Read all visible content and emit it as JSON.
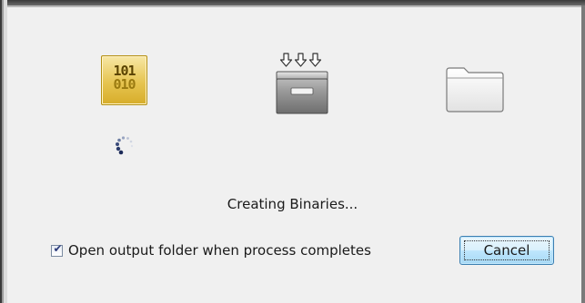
{
  "steps": {
    "binary_icon": {
      "name": "binary-icon",
      "line1": "101",
      "line2": "010"
    },
    "install_icon": {
      "name": "install-drive-icon"
    },
    "folder_icon": {
      "name": "folder-icon"
    },
    "spinner": {
      "name": "loading-spinner-icon"
    }
  },
  "status": {
    "text": "Creating Binaries..."
  },
  "options": {
    "open_folder_label": "Open output folder when process completes",
    "open_folder_checked": true
  },
  "buttons": {
    "cancel_label": "Cancel"
  },
  "colors": {
    "background": "#f0f0f0",
    "binary_gold": "#e6c450",
    "button_border": "#3c7fb1"
  }
}
